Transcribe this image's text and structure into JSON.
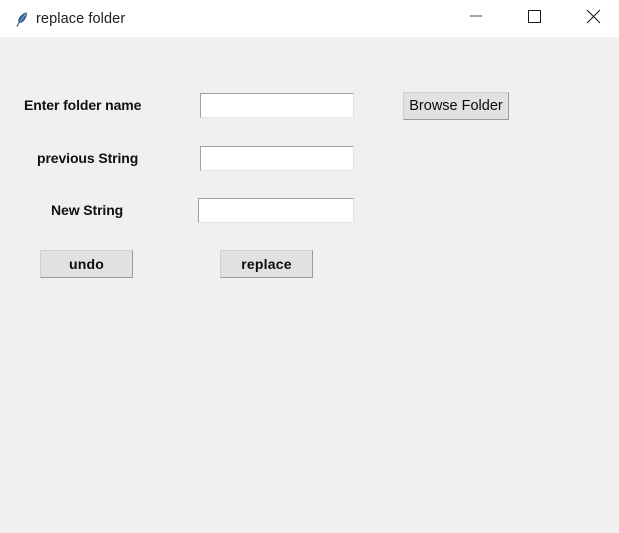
{
  "window": {
    "title": "replace folder",
    "icon": "python-feather-icon",
    "background_color": "#f0f0f0",
    "titlebar_color": "#ffffff"
  },
  "titlebar_controls": [
    {
      "name": "minimize-button",
      "icon": "minimize-icon",
      "label": "—"
    },
    {
      "name": "maximize-button",
      "icon": "maximize-icon",
      "label": "☐"
    },
    {
      "name": "close-button",
      "icon": "close-icon",
      "label": "✕"
    }
  ],
  "form": {
    "fields": [
      {
        "label": "Enter folder name",
        "value": "",
        "placeholder": ""
      },
      {
        "label": "previous String",
        "value": "",
        "placeholder": ""
      },
      {
        "label": "New String",
        "value": "",
        "placeholder": ""
      }
    ],
    "buttons": {
      "browse": "Browse Folder",
      "undo": "undo",
      "replace": "replace"
    }
  }
}
